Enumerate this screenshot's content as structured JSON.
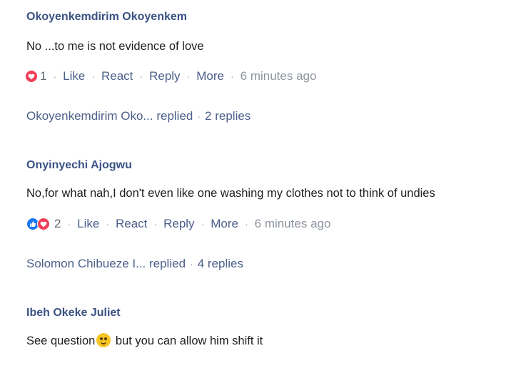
{
  "comments": [
    {
      "author": "Okoyenkemdirim Okoyenkem",
      "text": "No ...to  me is not evidence of love",
      "reaction_count": "1",
      "actions": {
        "like": "Like",
        "react": "React",
        "reply": "Reply",
        "more": "More"
      },
      "time": "6 minutes ago",
      "replies_by": "Okoyenkemdirim Oko... replied",
      "replies_count": "2 replies"
    },
    {
      "author": "Onyinyechi Ajogwu",
      "text": "No,for what nah,I don't even like one washing my clothes not to think of undies",
      "reaction_count": "2",
      "actions": {
        "like": "Like",
        "react": "React",
        "reply": "Reply",
        "more": "More"
      },
      "time": "6 minutes ago",
      "replies_by": "Solomon Chibueze I... replied",
      "replies_count": "4 replies"
    },
    {
      "author": "Ibeh Okeke Juliet",
      "text_before_emoji": "See question",
      "text_after_emoji": " but you can allow him shift it"
    }
  ],
  "colors": {
    "author": "#3b5284",
    "link": "#4b5f8a",
    "muted": "#8d949e",
    "heart": "#f33e58",
    "like": "#1877f2"
  }
}
